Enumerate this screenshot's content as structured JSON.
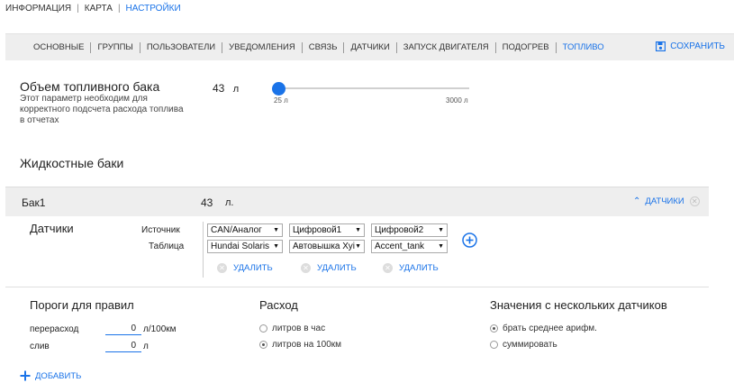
{
  "top_nav": {
    "items": [
      "ИНФОРМАЦИЯ",
      "КАРТА",
      "НАСТРОЙКИ"
    ]
  },
  "tabs": [
    "ОСНОВНЫЕ",
    "ГРУППЫ",
    "ПОЛЬЗОВАТЕЛИ",
    "УВЕДОМЛЕНИЯ",
    "СВЯЗЬ",
    "ДАТЧИКИ",
    "ЗАПУСК ДВИГАТЕЛЯ",
    "ПОДОГРЕВ",
    "ТОПЛИВО"
  ],
  "active_tab": "ТОПЛИВО",
  "save_label": "СОХРАНИТЬ",
  "tank_volume": {
    "title": "Объем топливного бака",
    "description": [
      "Этот параметр необходим для",
      "корректного подсчета расхода топлива",
      "в отчетах"
    ],
    "value": "43",
    "unit": "л",
    "slider": {
      "min_label": "25 л",
      "max_label": "3000 л",
      "min": 25,
      "max": 3000,
      "value": 43
    }
  },
  "liquid_tanks": {
    "title": "Жидкостные баки",
    "tank": {
      "name": "Бак1",
      "value": "43",
      "unit": "л.",
      "sensors_toggle": "ДАТЧИКИ",
      "sensors_label": "Датчики",
      "source_label": "Источник",
      "table_label": "Таблица",
      "columns": [
        {
          "source": "CAN/Аналог",
          "table": "Hundai Solaris",
          "delete": "УДАЛИТЬ"
        },
        {
          "source": "Цифровой1",
          "table": "Автовышка Хуі",
          "delete": "УДАЛИТЬ"
        },
        {
          "source": "Цифровой2",
          "table": "Accent_tank",
          "delete": "УДАЛИТЬ"
        }
      ]
    }
  },
  "thresholds": {
    "title": "Пороги для правил",
    "overspend_label": "перерасход",
    "overspend_value": "0",
    "overspend_unit": "л/100км",
    "drain_label": "слив",
    "drain_value": "0",
    "drain_unit": "л"
  },
  "consumption": {
    "title": "Расход",
    "options": [
      "литров в час",
      "литров на 100км"
    ],
    "selected_index": 1
  },
  "multi_sensor": {
    "title": "Значения с нескольких датчиков",
    "options": [
      "брать среднее арифм.",
      "суммировать"
    ],
    "selected_index": 0
  },
  "add_label": "ДОБАВИТЬ",
  "colors": {
    "accent": "#1a73e8",
    "bar_bg": "#eeeeee"
  }
}
